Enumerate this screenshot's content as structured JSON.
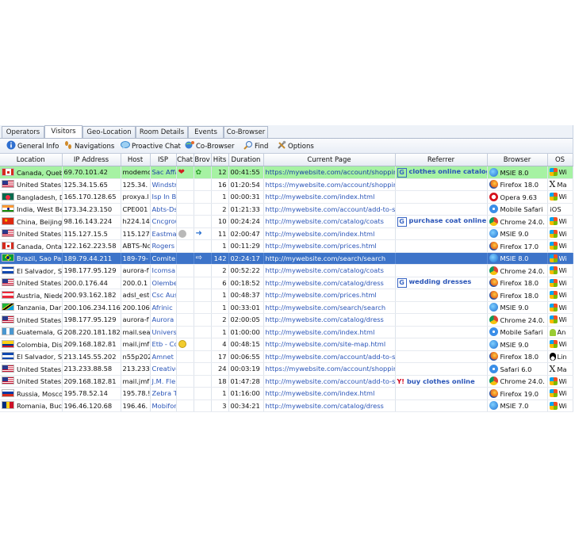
{
  "tabs": [
    "Operators",
    "Visitors",
    "Geo-Location",
    "Room Details",
    "Events",
    "Co-Browser"
  ],
  "active_tab": "Visitors",
  "toolbar": [
    {
      "label": "General Info",
      "icon": "info-icon"
    },
    {
      "label": "Navigations",
      "icon": "footsteps-icon"
    },
    {
      "label": "Proactive Chat",
      "icon": "chat-bubble-icon"
    },
    {
      "label": "Co-Browser",
      "icon": "co-browser-icon"
    },
    {
      "label": "Find",
      "icon": "search-icon"
    },
    {
      "label": "Options",
      "icon": "tools-icon"
    }
  ],
  "columns": [
    "Location",
    "IP Address",
    "Host",
    "ISP",
    "Chat",
    "Brov",
    "Hits",
    "Duration",
    "Current Page",
    "Referrer",
    "Browser",
    "OS"
  ],
  "rows": [
    {
      "flag": "canada",
      "location": "Canada, Queb",
      "ip": "69.70.101.42",
      "host": "modemc",
      "isp": "Sac Affa",
      "chat": "heart",
      "brow": "leaf",
      "hits": "12",
      "duration": "00:41:55",
      "page": "https://mywebsite.com/account/shopping-",
      "ref": "clothes online catalog",
      "ref_engine": "google",
      "browser": "MSIE 8.0",
      "bicon": "ie",
      "os": "Wi",
      "osicon": "windows",
      "highlight": "green"
    },
    {
      "flag": "usa",
      "location": "United States,",
      "ip": "125.34.15.65",
      "host": "125.34.",
      "isp": "Windstr",
      "chat": "",
      "brow": "",
      "hits": "16",
      "duration": "01:20:54",
      "page": "https://mywebsite.com/account/shopping-",
      "ref": "",
      "ref_engine": "",
      "browser": "Firefox 18.0",
      "bicon": "firefox",
      "os": "Ma",
      "osicon": "mac",
      "highlight": ""
    },
    {
      "flag": "bangladesh",
      "location": "Bangladesh, D",
      "ip": "165.170.128.65",
      "host": "proxya.l",
      "isp": "Isp In B",
      "chat": "",
      "brow": "",
      "hits": "1",
      "duration": "00:00:31",
      "page": "http://mywebsite.com/index.html",
      "ref": "",
      "ref_engine": "",
      "browser": "Opera 9.63",
      "bicon": "opera",
      "os": "Wi",
      "osicon": "windows",
      "highlight": ""
    },
    {
      "flag": "india",
      "location": "India, West Be",
      "ip": "173.34.23.150",
      "host": "CPE001",
      "isp": "Abts-Ds",
      "chat": "",
      "brow": "",
      "hits": "2",
      "duration": "01:21:33",
      "page": "http://mywebsite.com/account/add-to-sh",
      "ref": "",
      "ref_engine": "",
      "browser": "Mobile Safari",
      "bicon": "safari",
      "os": "iOS",
      "osicon": "ios",
      "highlight": ""
    },
    {
      "flag": "china",
      "location": "China, Beijing,",
      "ip": "98.16.143.224",
      "host": "h224.14",
      "isp": "Cncgrou",
      "chat": "",
      "brow": "",
      "hits": "10",
      "duration": "00:24:24",
      "page": "http://mywebsite.com/catalog/coats",
      "ref": "purchase coat online",
      "ref_engine": "google",
      "browser": "Chrome 24.0.",
      "bicon": "chrome",
      "os": "Wi",
      "osicon": "windows",
      "highlight": ""
    },
    {
      "flag": "usa",
      "location": "United States,",
      "ip": "115.127.15.5",
      "host": "115.127",
      "isp": "Eastmar",
      "chat": "face-gray",
      "brow": "arrow",
      "hits": "11",
      "duration": "02:00:47",
      "page": "http://mywebsite.com/index.html",
      "ref": "",
      "ref_engine": "",
      "browser": "MSIE 9.0",
      "bicon": "ie",
      "os": "Wi",
      "osicon": "windows",
      "highlight": ""
    },
    {
      "flag": "canada",
      "location": "Canada, Onta",
      "ip": "122.162.223.58",
      "host": "ABTS-Nc",
      "isp": "Rogers",
      "chat": "",
      "brow": "",
      "hits": "1",
      "duration": "00:11:29",
      "page": "http://mywebsite.com/prices.html",
      "ref": "",
      "ref_engine": "",
      "browser": "Firefox 17.0",
      "bicon": "firefox",
      "os": "Wi",
      "osicon": "windows",
      "highlight": ""
    },
    {
      "flag": "brazil",
      "location": "Brazil, Sao Pau",
      "ip": "189.79.44.211",
      "host": "189-79-",
      "isp": "Comite (",
      "chat": "",
      "brow": "arrow-box",
      "hits": "142",
      "duration": "02:24:17",
      "page": "http://mywebsite.com/search/search",
      "ref": "",
      "ref_engine": "",
      "browser": "MSIE 8.0",
      "bicon": "ie",
      "os": "Wi",
      "osicon": "windows",
      "highlight": "blue"
    },
    {
      "flag": "elsalvador",
      "location": "El Salvador, Sa",
      "ip": "198.177.95.129",
      "host": "aurora-f",
      "isp": "Icomsa",
      "chat": "",
      "brow": "",
      "hits": "2",
      "duration": "00:52:22",
      "page": "http://mywebsite.com/catalog/coats",
      "ref": "",
      "ref_engine": "",
      "browser": "Chrome 24.0.",
      "bicon": "chrome",
      "os": "Wi",
      "osicon": "windows",
      "highlight": ""
    },
    {
      "flag": "usa",
      "location": "United States,",
      "ip": "200.0.176.44",
      "host": "200.0.1",
      "isp": "Olembe",
      "chat": "",
      "brow": "",
      "hits": "6",
      "duration": "00:18:52",
      "page": "http://mywebsite.com/catalog/dress",
      "ref": "wedding dresses",
      "ref_engine": "google",
      "browser": "Firefox 18.0",
      "bicon": "firefox",
      "os": "Wi",
      "osicon": "windows",
      "highlight": ""
    },
    {
      "flag": "austria",
      "location": "Austria, Niede",
      "ip": "200.93.162.182",
      "host": "adsl_est",
      "isp": "Csc Aus",
      "chat": "",
      "brow": "",
      "hits": "1",
      "duration": "00:48:37",
      "page": "http://mywebsite.com/prices.html",
      "ref": "",
      "ref_engine": "",
      "browser": "Firefox 18.0",
      "bicon": "firefox",
      "os": "Wi",
      "osicon": "windows",
      "highlight": ""
    },
    {
      "flag": "tanzania",
      "location": "Tanzania, Dar",
      "ip": "200.106.234.116",
      "host": "200.106",
      "isp": "Afrinic",
      "chat": "",
      "brow": "",
      "hits": "1",
      "duration": "00:33:01",
      "page": "http://mywebsite.com/search/search",
      "ref": "",
      "ref_engine": "",
      "browser": "MSIE 9.0",
      "bicon": "ie",
      "os": "Wi",
      "osicon": "windows",
      "highlight": ""
    },
    {
      "flag": "usa",
      "location": "United States,",
      "ip": "198.177.95.129",
      "host": "aurora-f",
      "isp": "Aurora I",
      "chat": "",
      "brow": "",
      "hits": "2",
      "duration": "02:00:05",
      "page": "http://mywebsite.com/catalog/dress",
      "ref": "",
      "ref_engine": "",
      "browser": "Chrome 24.0.",
      "bicon": "chrome",
      "os": "Wi",
      "osicon": "windows",
      "highlight": ""
    },
    {
      "flag": "guatemala",
      "location": "Guatemala, Gu",
      "ip": "208.220.181.182",
      "host": "mail.sea",
      "isp": "Universi",
      "chat": "",
      "brow": "",
      "hits": "1",
      "duration": "01:00:00",
      "page": "http://mywebsite.com/index.html",
      "ref": "",
      "ref_engine": "",
      "browser": "Mobile Safari",
      "bicon": "safari",
      "os": "An",
      "osicon": "android",
      "highlight": ""
    },
    {
      "flag": "colombia",
      "location": "Colombia, Dist",
      "ip": "209.168.182.81",
      "host": "mail.jmf",
      "isp": "Etb - Co",
      "chat": "face-yellow",
      "brow": "",
      "hits": "4",
      "duration": "00:48:15",
      "page": "http://mywebsite.com/site-map.html",
      "ref": "",
      "ref_engine": "",
      "browser": "MSIE 9.0",
      "bicon": "ie",
      "os": "Wi",
      "osicon": "windows",
      "highlight": ""
    },
    {
      "flag": "elsalvador",
      "location": "El Salvador, Sa",
      "ip": "213.145.55.202",
      "host": "n55p202",
      "isp": "Amnet D",
      "chat": "",
      "brow": "",
      "hits": "17",
      "duration": "00:06:55",
      "page": "http://mywebsite.com/account/add-to-sh",
      "ref": "",
      "ref_engine": "",
      "browser": "Firefox 18.0",
      "bicon": "firefox",
      "os": "Lin",
      "osicon": "linux",
      "highlight": ""
    },
    {
      "flag": "usa",
      "location": "United States,",
      "ip": "213.233.88.58",
      "host": "213.233",
      "isp": "Creative",
      "chat": "",
      "brow": "",
      "hits": "24",
      "duration": "00:03:19",
      "page": "https://mywebsite.com/account/shopping-",
      "ref": "",
      "ref_engine": "",
      "browser": "Safari 6.0",
      "bicon": "safari",
      "os": "Ma",
      "osicon": "mac",
      "highlight": ""
    },
    {
      "flag": "usa",
      "location": "United States,",
      "ip": "209.168.182.81",
      "host": "mail.jmf",
      "isp": "J.M. Fle",
      "chat": "",
      "brow": "",
      "hits": "18",
      "duration": "01:47:28",
      "page": "http://mywebsite.com/account/add-to-sh",
      "ref": "buy clothes online",
      "ref_engine": "yahoo",
      "browser": "Chrome 24.0.",
      "bicon": "chrome",
      "os": "Wi",
      "osicon": "windows",
      "highlight": ""
    },
    {
      "flag": "russia",
      "location": "Russia, Mosco",
      "ip": "195.78.52.14",
      "host": "195.78.!",
      "isp": "Zebra Te",
      "chat": "",
      "brow": "",
      "hits": "1",
      "duration": "01:16:00",
      "page": "http://mywebsite.com/index.html",
      "ref": "",
      "ref_engine": "",
      "browser": "Firefox 19.0",
      "bicon": "firefox",
      "os": "Wi",
      "osicon": "windows",
      "highlight": ""
    },
    {
      "flag": "romania",
      "location": "Romania, Bucu",
      "ip": "196.46.120.68",
      "host": "196.46.",
      "isp": "Mobifon",
      "chat": "",
      "brow": "",
      "hits": "3",
      "duration": "00:34:21",
      "page": "http://mywebsite.com/catalog/dress",
      "ref": "",
      "ref_engine": "",
      "browser": "MSIE 7.0",
      "bicon": "ie",
      "os": "Wi",
      "osicon": "windows",
      "highlight": ""
    }
  ],
  "colors": {
    "highlight_green": "#a6f2a3",
    "highlight_blue": "#3d74c9",
    "link": "#2a55b8"
  }
}
